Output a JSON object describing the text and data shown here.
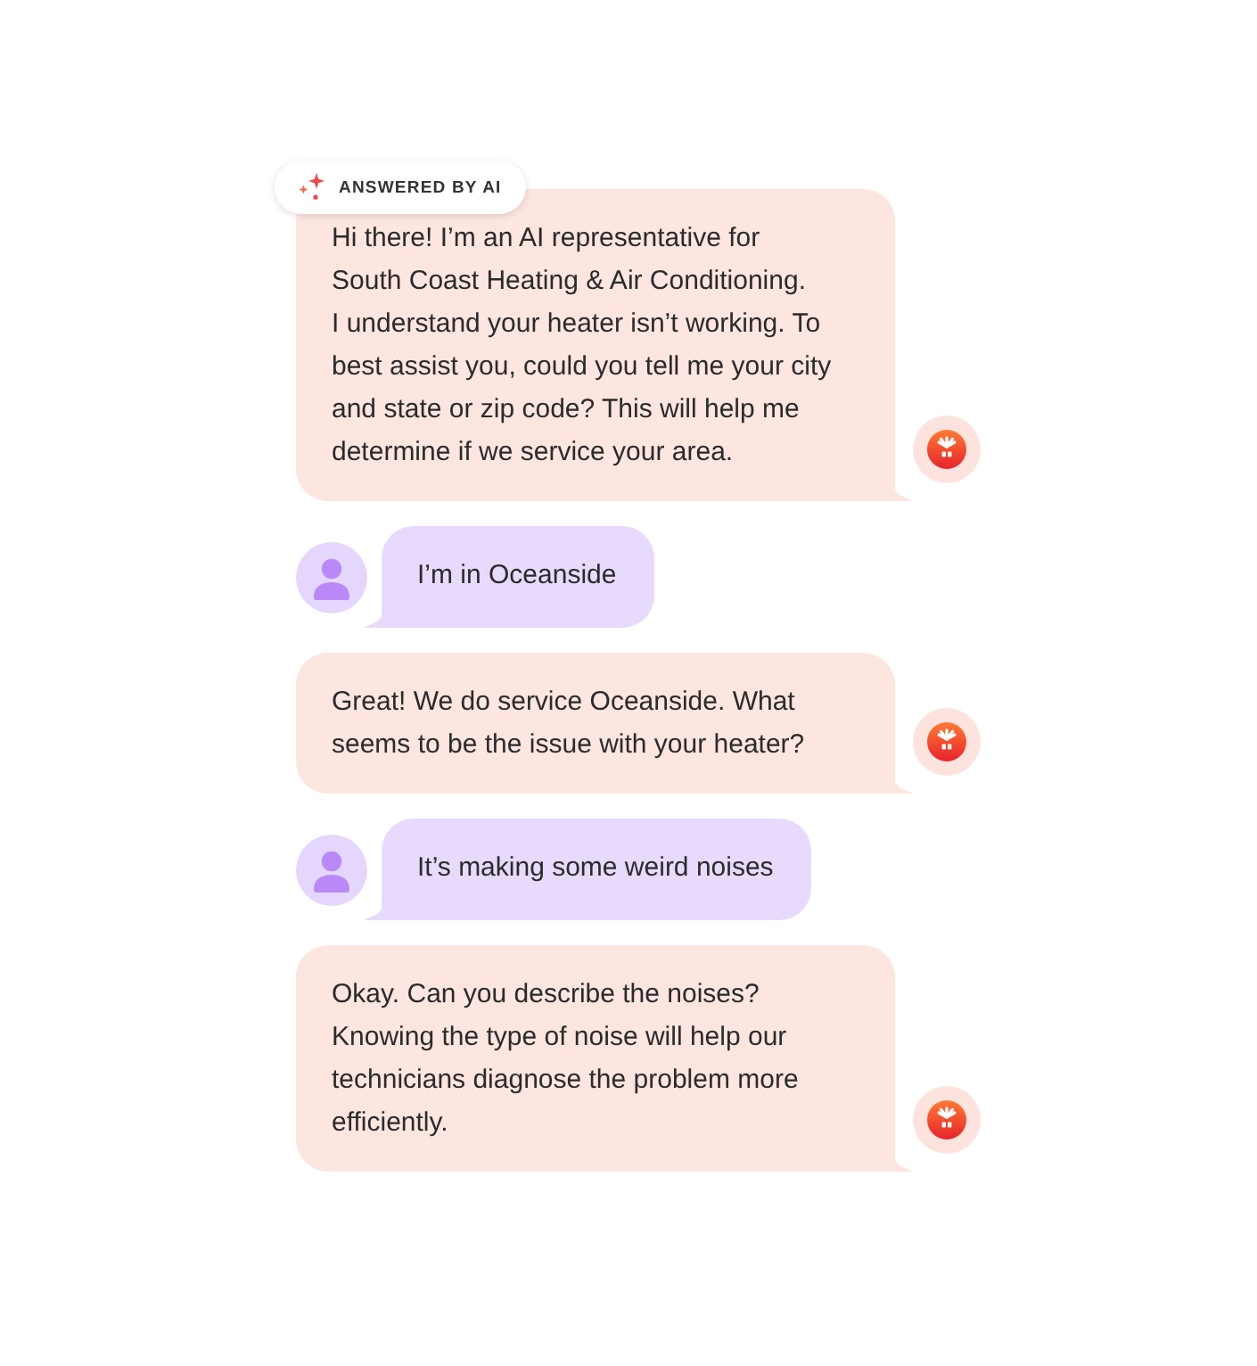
{
  "messages": [
    {
      "kind": "ai",
      "badge": "ANSWERED BY AI",
      "text": "Hi there! I’m an AI representative for\nSouth Coast Heating & Air Conditioning.\nI understand your heater isn’t working. To\nbest assist you, could you tell me your city\nand state or zip code? This will help me\ndetermine if we service your area."
    },
    {
      "kind": "user",
      "text": "I’m in Oceanside"
    },
    {
      "kind": "ai",
      "text": "Great! We do service Oceanside. What\nseems to be the issue with your heater?"
    },
    {
      "kind": "user",
      "text": "It’s making some weird noises"
    },
    {
      "kind": "ai",
      "text": "Okay. Can you describe the noises?\nKnowing the type of noise will help our\ntechnicians diagnose the problem more\nefficiently."
    }
  ]
}
